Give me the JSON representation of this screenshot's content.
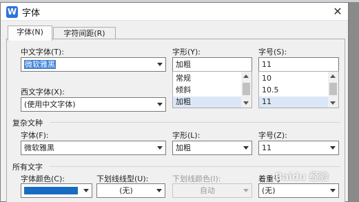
{
  "window": {
    "title": "字体",
    "close_icon": "close-icon"
  },
  "tabs": [
    {
      "label": "字体(N)",
      "active": true
    },
    {
      "label": "字符间距(R)",
      "active": false
    }
  ],
  "chinese_font": {
    "label": "中文字体(T):",
    "value": "微软雅黑"
  },
  "style": {
    "label": "字形(Y):",
    "value": "加粗",
    "options": [
      "常规",
      "倾斜",
      "加粗"
    ],
    "selected": "加粗"
  },
  "size": {
    "label": "字号(S):",
    "value": "11",
    "options": [
      "10",
      "10.5",
      "11"
    ],
    "selected": "11"
  },
  "western_font": {
    "label": "西文字体(X):",
    "value": "(使用中文字体)"
  },
  "complex_section": {
    "heading": "复杂文种",
    "font": {
      "label": "字体(F):",
      "value": "微软雅黑"
    },
    "style": {
      "label": "字形(L):",
      "value": "加粗"
    },
    "size": {
      "label": "字号(Z):",
      "value": "11"
    }
  },
  "all_text_section": {
    "heading": "所有文字",
    "font_color": {
      "label": "字体颜色(C):",
      "swatch": "#1a6bc2"
    },
    "underline_style": {
      "label": "下划线线型(U):",
      "value": "(无)"
    },
    "underline_color": {
      "label": "下划线颜色(I):",
      "value": "自动",
      "disabled": true
    },
    "emphasis": {
      "label": "着重号",
      "value": "(无)"
    }
  },
  "watermark": "Baidu 经验",
  "colors": {
    "accent": "#3d7fd6",
    "app_icon": "#2f73d8",
    "panel_bg": "#f0f0f0"
  }
}
